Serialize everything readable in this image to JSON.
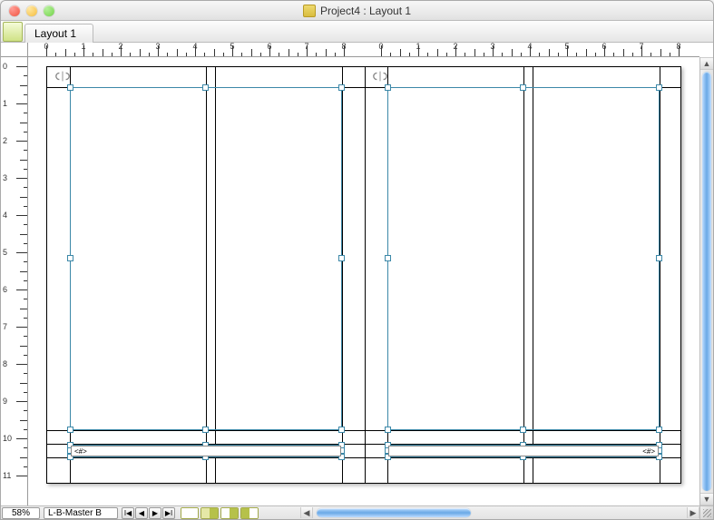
{
  "window": {
    "title": "Project4 : Layout 1"
  },
  "tabs": {
    "active": "Layout 1"
  },
  "ruler": {
    "h_labels": [
      "0",
      "1",
      "2",
      "3",
      "4",
      "5",
      "6",
      "7",
      "8",
      "0",
      "1",
      "2",
      "3",
      "4",
      "5",
      "6",
      "7",
      "8"
    ],
    "v_labels": [
      "0",
      "1",
      "2",
      "3",
      "4",
      "5",
      "6",
      "7",
      "8",
      "9",
      "10",
      "11"
    ]
  },
  "canvas": {
    "page_number_placeholder": "<#>"
  },
  "statusbar": {
    "zoom": "58%",
    "page": "L-B-Master B"
  }
}
